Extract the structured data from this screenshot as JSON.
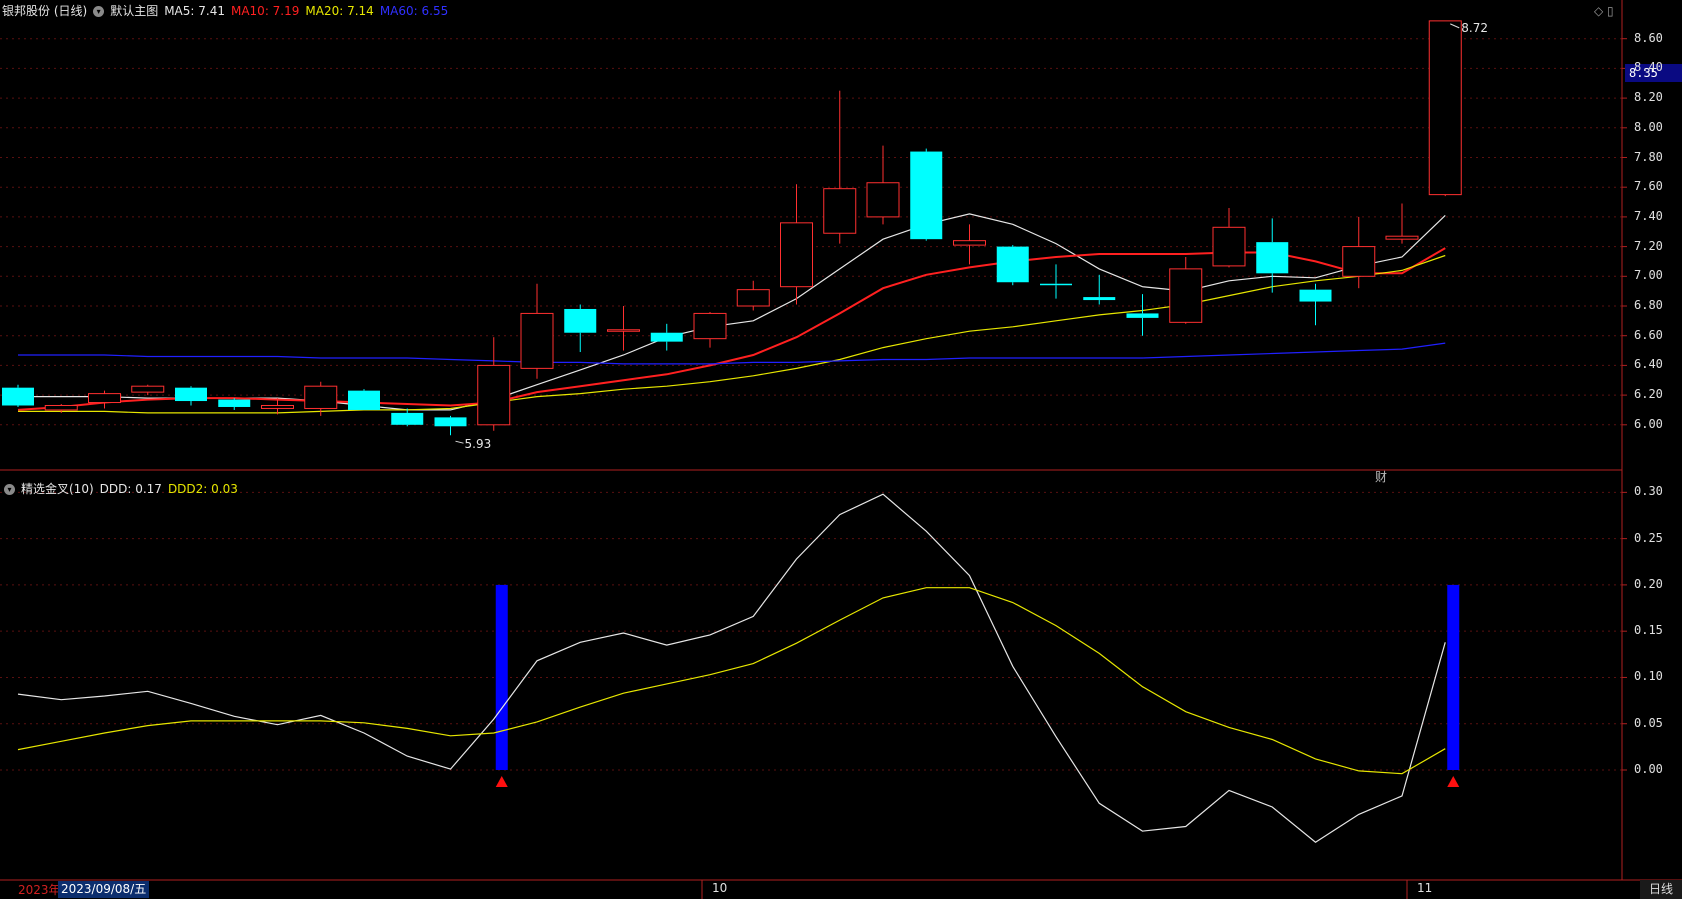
{
  "main_panel": {
    "symbol": "银邦股份 (日线)",
    "template_label": "默认主图",
    "ma": [
      {
        "label": "MA5: 7.41",
        "color": "#e6e6e6"
      },
      {
        "label": "MA10: 7.19",
        "color": "#ff2020"
      },
      {
        "label": "MA20: 7.14",
        "color": "#e6e600"
      },
      {
        "label": "MA60: 6.55",
        "color": "#2020ff"
      }
    ],
    "current_price": "8.35",
    "high_label": "8.72",
    "low_label": "5.93",
    "finance_marker": "财"
  },
  "sub_panel": {
    "indicator": "精选金叉(10)",
    "ddd_label": "DDD: 0.17",
    "ddd2_label": "DDD2: 0.03"
  },
  "dates": {
    "year_label": "2023年",
    "cursor_date": "2023/09/08/五",
    "month_10": "10",
    "month_11": "11"
  },
  "mode_button": "日线",
  "top_icons": "◇ ▯",
  "chart_data": [
    {
      "type": "candlestick",
      "ylim": [
        5.85,
        8.75
      ],
      "yticks": [
        "8.60",
        "8.40",
        "8.20",
        "8.00",
        "7.80",
        "7.60",
        "7.40",
        "7.20",
        "7.00",
        "6.80",
        "6.60",
        "6.40",
        "6.20",
        "6.00"
      ],
      "candles": [
        {
          "o": 6.25,
          "h": 6.27,
          "l": 6.12,
          "c": 6.13
        },
        {
          "o": 6.1,
          "h": 6.14,
          "l": 6.08,
          "c": 6.13
        },
        {
          "o": 6.15,
          "h": 6.23,
          "l": 6.11,
          "c": 6.21
        },
        {
          "o": 6.22,
          "h": 6.27,
          "l": 6.2,
          "c": 6.26
        },
        {
          "o": 6.25,
          "h": 6.26,
          "l": 6.13,
          "c": 6.16
        },
        {
          "o": 6.17,
          "h": 6.18,
          "l": 6.1,
          "c": 6.12
        },
        {
          "o": 6.11,
          "h": 6.18,
          "l": 6.07,
          "c": 6.13
        },
        {
          "o": 6.11,
          "h": 6.29,
          "l": 6.06,
          "c": 6.26
        },
        {
          "o": 6.23,
          "h": 6.24,
          "l": 6.1,
          "c": 6.1
        },
        {
          "o": 6.08,
          "h": 6.11,
          "l": 5.99,
          "c": 6.0
        },
        {
          "o": 6.05,
          "h": 6.06,
          "l": 5.93,
          "c": 5.99
        },
        {
          "o": 6.0,
          "h": 6.59,
          "l": 5.96,
          "c": 6.4
        },
        {
          "o": 6.38,
          "h": 6.95,
          "l": 6.31,
          "c": 6.75
        },
        {
          "o": 6.78,
          "h": 6.81,
          "l": 6.49,
          "c": 6.62
        },
        {
          "o": 6.64,
          "h": 6.8,
          "l": 6.5,
          "c": 6.64
        },
        {
          "o": 6.62,
          "h": 6.68,
          "l": 6.5,
          "c": 6.56
        },
        {
          "o": 6.58,
          "h": 6.76,
          "l": 6.52,
          "c": 6.75
        },
        {
          "o": 6.8,
          "h": 6.97,
          "l": 6.77,
          "c": 6.91
        },
        {
          "o": 6.93,
          "h": 7.62,
          "l": 6.81,
          "c": 7.36
        },
        {
          "o": 7.29,
          "h": 8.25,
          "l": 7.22,
          "c": 7.59
        },
        {
          "o": 7.4,
          "h": 7.88,
          "l": 7.35,
          "c": 7.63
        },
        {
          "o": 7.84,
          "h": 7.86,
          "l": 7.24,
          "c": 7.25
        },
        {
          "o": 7.21,
          "h": 7.35,
          "l": 7.08,
          "c": 7.24
        },
        {
          "o": 7.2,
          "h": 7.21,
          "l": 6.94,
          "c": 6.96
        },
        {
          "o": 6.95,
          "h": 7.08,
          "l": 6.85,
          "c": 6.94
        },
        {
          "o": 6.86,
          "h": 7.01,
          "l": 6.81,
          "c": 6.84
        },
        {
          "o": 6.75,
          "h": 6.88,
          "l": 6.6,
          "c": 6.72
        },
        {
          "o": 6.69,
          "h": 7.13,
          "l": 6.68,
          "c": 7.05
        },
        {
          "o": 7.07,
          "h": 7.46,
          "l": 7.06,
          "c": 7.33
        },
        {
          "o": 7.23,
          "h": 7.39,
          "l": 6.89,
          "c": 7.02
        },
        {
          "o": 6.91,
          "h": 6.95,
          "l": 6.67,
          "c": 6.83
        },
        {
          "o": 7.0,
          "h": 7.4,
          "l": 6.92,
          "c": 7.2
        },
        {
          "o": 7.25,
          "h": 7.49,
          "l": 7.22,
          "c": 7.27
        },
        {
          "o": 7.55,
          "h": 8.72,
          "l": 7.54,
          "c": 8.72
        }
      ],
      "series": [
        {
          "name": "MA5",
          "color": "#e6e6e6",
          "values": [
            6.19,
            6.19,
            6.19,
            6.18,
            6.18,
            6.18,
            6.18,
            6.16,
            6.13,
            6.1,
            6.1,
            6.17,
            6.27,
            6.37,
            6.47,
            6.59,
            6.66,
            6.7,
            6.85,
            7.05,
            7.25,
            7.35,
            7.42,
            7.35,
            7.22,
            7.05,
            6.93,
            6.9,
            6.97,
            7.0,
            6.99,
            7.07,
            7.13,
            7.41
          ]
        },
        {
          "name": "MA10",
          "color": "#ff2020",
          "values": [
            6.1,
            6.12,
            6.15,
            6.17,
            6.18,
            6.18,
            6.17,
            6.16,
            6.15,
            6.14,
            6.13,
            6.15,
            6.22,
            6.26,
            6.3,
            6.34,
            6.4,
            6.47,
            6.59,
            6.75,
            6.92,
            7.01,
            7.06,
            7.1,
            7.13,
            7.15,
            7.15,
            7.15,
            7.16,
            7.16,
            7.1,
            7.02,
            7.02,
            7.19
          ]
        },
        {
          "name": "MA20",
          "color": "#e6e600",
          "values": [
            6.09,
            6.09,
            6.09,
            6.08,
            6.08,
            6.08,
            6.08,
            6.09,
            6.1,
            6.1,
            6.11,
            6.15,
            6.19,
            6.21,
            6.24,
            6.26,
            6.29,
            6.33,
            6.38,
            6.44,
            6.52,
            6.58,
            6.63,
            6.66,
            6.7,
            6.74,
            6.77,
            6.81,
            6.87,
            6.93,
            6.97,
            7.0,
            7.04,
            7.14
          ]
        },
        {
          "name": "MA60",
          "color": "#2020ff",
          "values": [
            6.47,
            6.47,
            6.47,
            6.46,
            6.46,
            6.46,
            6.46,
            6.45,
            6.45,
            6.45,
            6.44,
            6.43,
            6.42,
            6.42,
            6.41,
            6.41,
            6.41,
            6.42,
            6.42,
            6.43,
            6.44,
            6.44,
            6.45,
            6.45,
            6.45,
            6.45,
            6.45,
            6.46,
            6.47,
            6.48,
            6.49,
            6.5,
            6.51,
            6.55
          ]
        }
      ]
    },
    {
      "type": "line",
      "ylim": [
        -0.05,
        0.31
      ],
      "yticks": [
        "0.30",
        "0.25",
        "0.20",
        "0.15",
        "0.10",
        "0.05",
        "0.00"
      ],
      "series": [
        {
          "name": "DDD",
          "color": "#e6e6e6",
          "values": [
            0.082,
            0.076,
            0.08,
            0.085,
            0.072,
            0.058,
            0.049,
            0.059,
            0.04,
            0.015,
            0.001,
            0.055,
            0.118,
            0.138,
            0.148,
            0.135,
            0.146,
            0.166,
            0.228,
            0.276,
            0.298,
            0.258,
            0.21,
            0.112,
            0.036,
            -0.036,
            -0.066,
            -0.061,
            -0.022,
            -0.04,
            -0.078,
            -0.048,
            -0.028,
            0.138
          ]
        },
        {
          "name": "DDD2",
          "color": "#e6e600",
          "values": [
            0.022,
            0.031,
            0.04,
            0.048,
            0.053,
            0.053,
            0.053,
            0.053,
            0.051,
            0.045,
            0.037,
            0.04,
            0.052,
            0.068,
            0.083,
            0.093,
            0.103,
            0.115,
            0.137,
            0.162,
            0.186,
            0.197,
            0.197,
            0.181,
            0.156,
            0.126,
            0.09,
            0.063,
            0.046,
            0.033,
            0.012,
            -0.001,
            -0.004,
            0.023
          ]
        }
      ],
      "signals": [
        {
          "index": 11,
          "value": 0.2,
          "color": "#0000ff",
          "marker": "red-triangle-up"
        },
        {
          "index": 33,
          "value": 0.2,
          "color": "#0000ff",
          "marker": "red-triangle-up"
        }
      ]
    }
  ]
}
